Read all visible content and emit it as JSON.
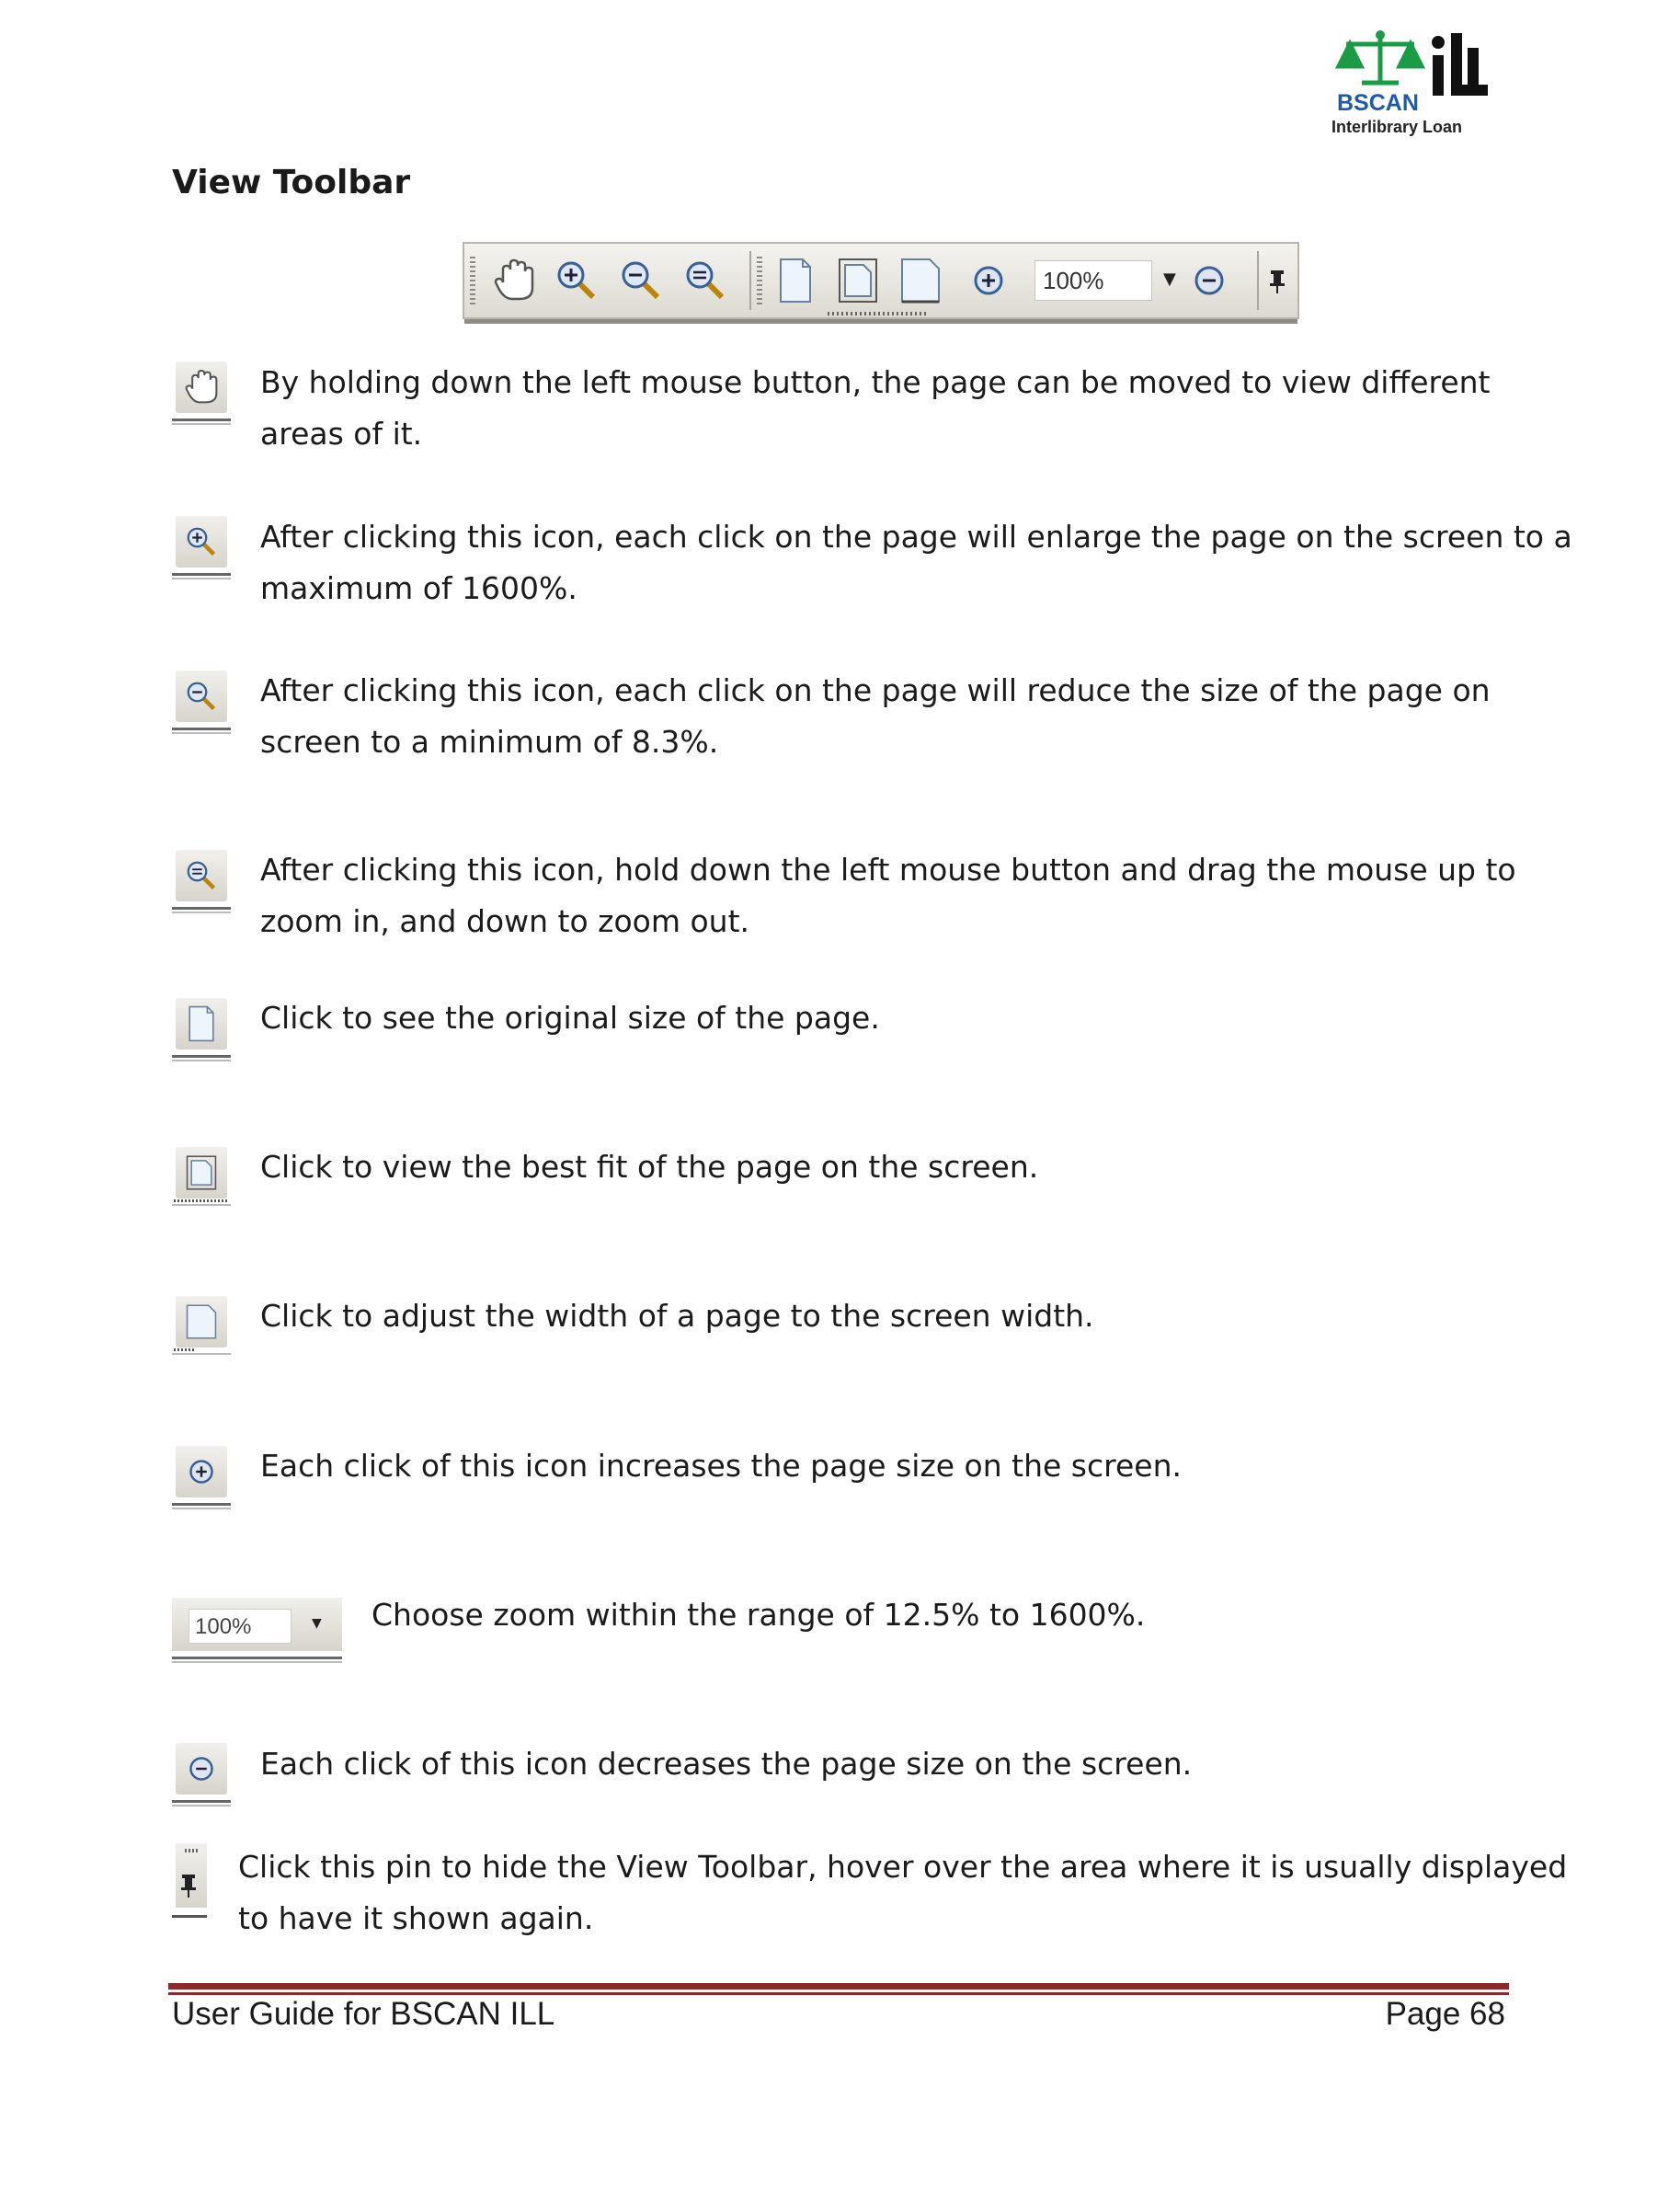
{
  "logo": {
    "name": "BSCAN",
    "sub": "Interlibrary Loan",
    "icon": "scales-of-justice-logo"
  },
  "title": "View Toolbar",
  "toolbar": {
    "zoom_value": "100%"
  },
  "items": [
    {
      "icon": "hand-icon",
      "text_lines": [
        "By holding down the left mouse button, the page can be moved to view different",
        "areas of it."
      ]
    },
    {
      "icon": "zoom-in-magnifier-icon",
      "text_lines": [
        "After clicking this icon, each click on the page will enlarge the page on the screen to a",
        "maximum of 1600%."
      ]
    },
    {
      "icon": "zoom-out-magnifier-icon",
      "text_lines": [
        "After clicking this icon, each click on the page will reduce the size of the page on",
        "screen to a minimum of 8.3%."
      ]
    },
    {
      "icon": "dynamic-zoom-icon",
      "text_lines": [
        "After clicking this icon, hold down the left mouse button and drag the mouse up to",
        "zoom in, and down to zoom out."
      ]
    },
    {
      "icon": "actual-size-page-icon",
      "text_lines": [
        "Click to see the original size of the page."
      ]
    },
    {
      "icon": "fit-page-icon",
      "text_lines": [
        "Click to view the best fit of the page on the screen."
      ]
    },
    {
      "icon": "fit-width-page-icon",
      "text_lines": [
        "Click to adjust the width of a page to the screen width."
      ]
    },
    {
      "icon": "zoom-increase-icon",
      "text_lines": [
        "Each click of this icon increases the page size on the screen."
      ]
    },
    {
      "icon": "zoom-select-dropdown",
      "value": "100%",
      "text_lines": [
        "Choose zoom within the range of 12.5% to 1600%."
      ]
    },
    {
      "icon": "zoom-decrease-icon",
      "text_lines": [
        "Each click of this icon decreases the page size on the screen."
      ]
    },
    {
      "icon": "pin-icon",
      "text_lines": [
        "Click this pin to hide the View Toolbar, hover over the area where it is usually displayed",
        "to have it shown again."
      ]
    }
  ],
  "footer": {
    "left": "User Guide for BSCAN ILL",
    "right": "Page 68"
  },
  "colors": {
    "logo_green": "#1a9b45",
    "logo_blue": "#1f5aa8",
    "footer_rule": "#8a2a2a"
  }
}
